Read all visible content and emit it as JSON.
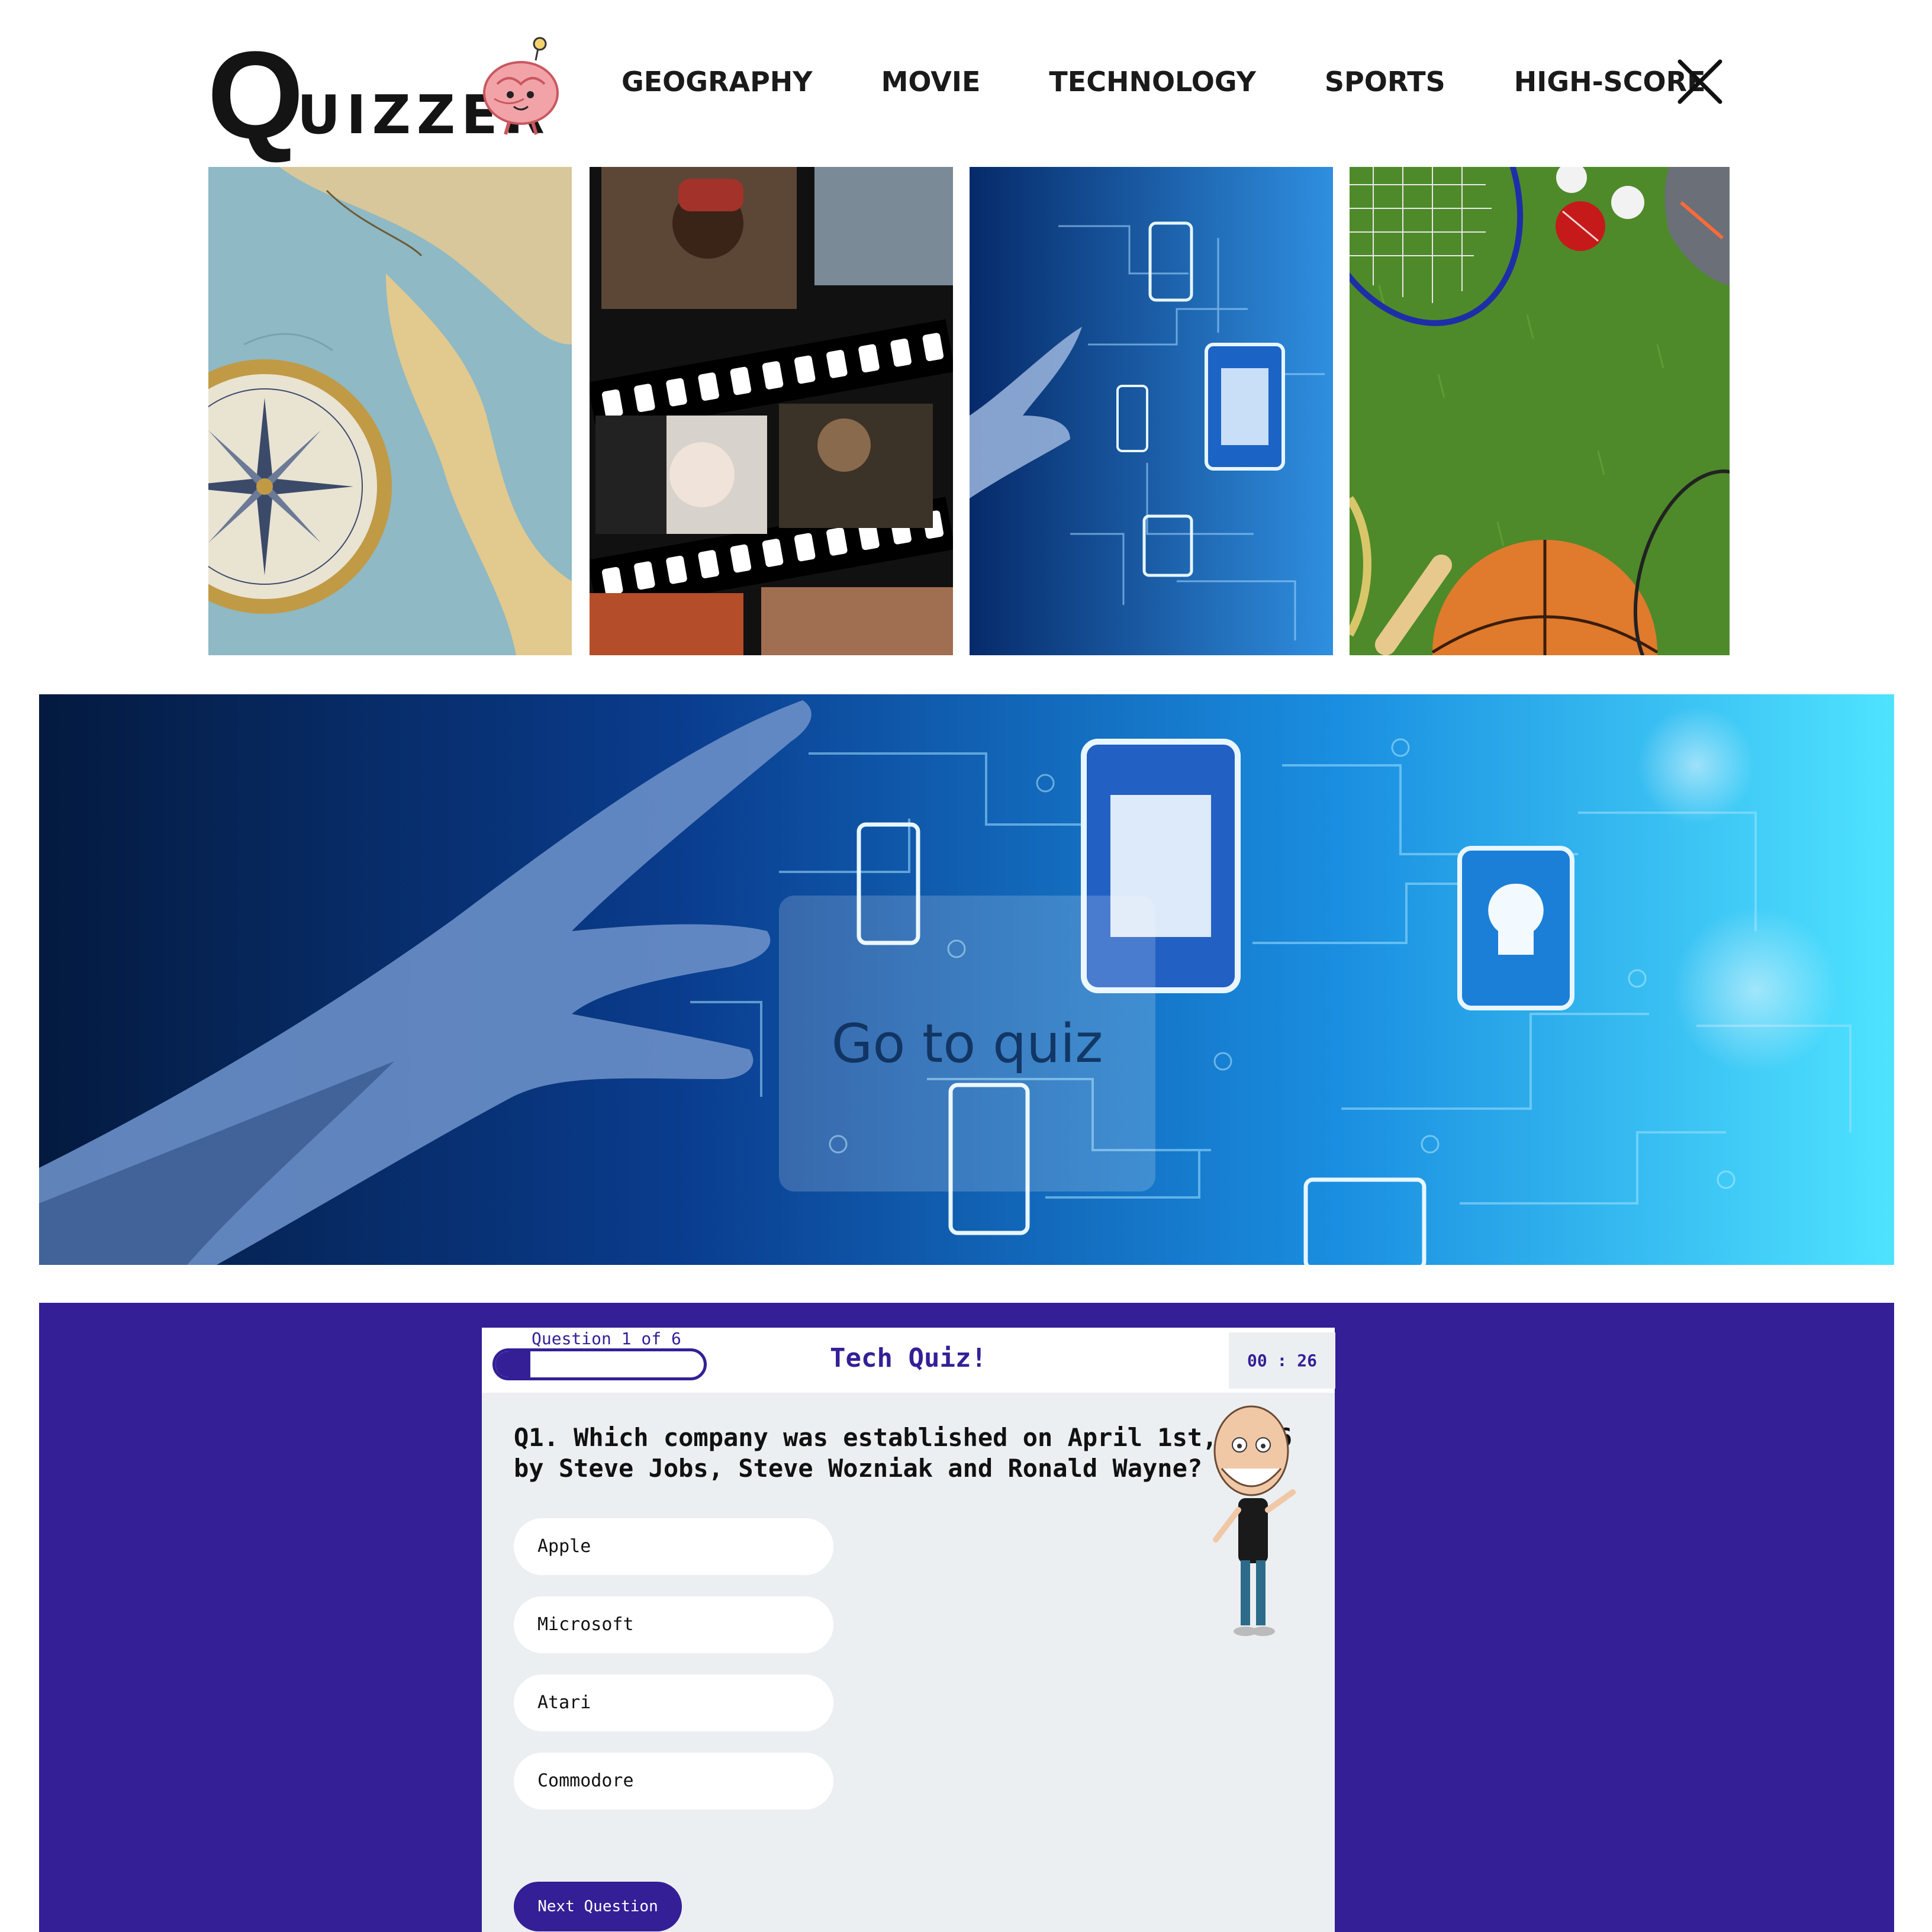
{
  "header": {
    "logo_letter": "Q",
    "logo_rest": "UIZZER",
    "logo_icon": "brain-mascot-icon",
    "nav": [
      {
        "label": "GEOGRAPHY"
      },
      {
        "label": "MOVIE"
      },
      {
        "label": "TECHNOLOGY"
      },
      {
        "label": "SPORTS"
      },
      {
        "label": "HIGH-SCORE"
      }
    ],
    "close_icon": "close-icon"
  },
  "tiles": [
    {
      "category": "geography",
      "image": "map-compass-image"
    },
    {
      "category": "movie",
      "image": "film-strip-image"
    },
    {
      "category": "technology",
      "image": "circuit-hand-image"
    },
    {
      "category": "sports",
      "image": "sports-equipment-image"
    }
  ],
  "banner": {
    "cta_label": "Go to quiz",
    "image": "technology-banner-image"
  },
  "quiz": {
    "question_counter": "Question 1 of 6",
    "progress_fraction": 0.1667,
    "title": "Tech Quiz!",
    "timer": "00 : 26",
    "question": "Q1. Which company was established on April 1st, 1976 by Steve Jobs, Steve Wozniak and Ronald Wayne?",
    "options": [
      {
        "label": "Apple"
      },
      {
        "label": "Microsoft"
      },
      {
        "label": "Atari"
      },
      {
        "label": "Commodore"
      }
    ],
    "next_label": "Next Question",
    "character_icon": "caricature-character-icon"
  },
  "colors": {
    "brand_purple": "#341f97",
    "card_bg": "#eceff1",
    "text_dark": "#141414"
  }
}
